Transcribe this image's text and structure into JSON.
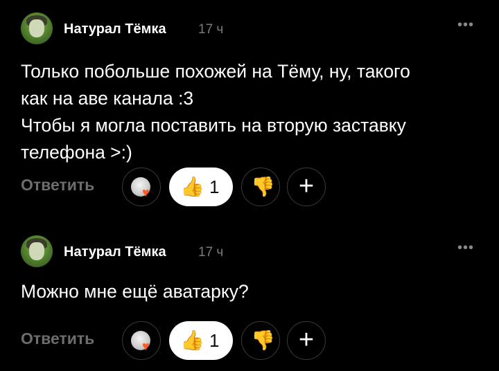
{
  "comments": [
    {
      "author": "Натурал Тёмка",
      "time": "17 ч",
      "more": "•••",
      "text_lines": [
        "Только побольше похожей на Тёму, ну, такого",
        "как на аве канала :3",
        "Чтобы я могла поставить на вторую заставку",
        "телефона >:)"
      ],
      "reply_label": "Ответить",
      "like_icon": "👍",
      "like_count": "1",
      "dislike_icon": "👎",
      "add_reaction": "+",
      "reactor_heart": "♥"
    },
    {
      "author": "Натурал Тёмка",
      "time": "17 ч",
      "more": "•••",
      "text_lines": [
        "Можно мне ещё аватарку?"
      ],
      "reply_label": "Ответить",
      "like_icon": "👍",
      "like_count": "1",
      "dislike_icon": "👎",
      "add_reaction": "+",
      "reactor_heart": "♥"
    }
  ],
  "colors": {
    "background": "#000000",
    "text": "#ffffff",
    "muted": "#7a7a7a",
    "reply": "#6d6d6d",
    "like_bg": "#ffffff",
    "border": "#3a3a3a",
    "heart": "#ff5a1f"
  },
  "icons": {
    "avatar": "user-avatar",
    "more": "more-dots-icon",
    "like": "thumbs-up-icon",
    "dislike": "thumbs-down-icon",
    "add": "plus-icon",
    "heart": "heart-icon"
  }
}
